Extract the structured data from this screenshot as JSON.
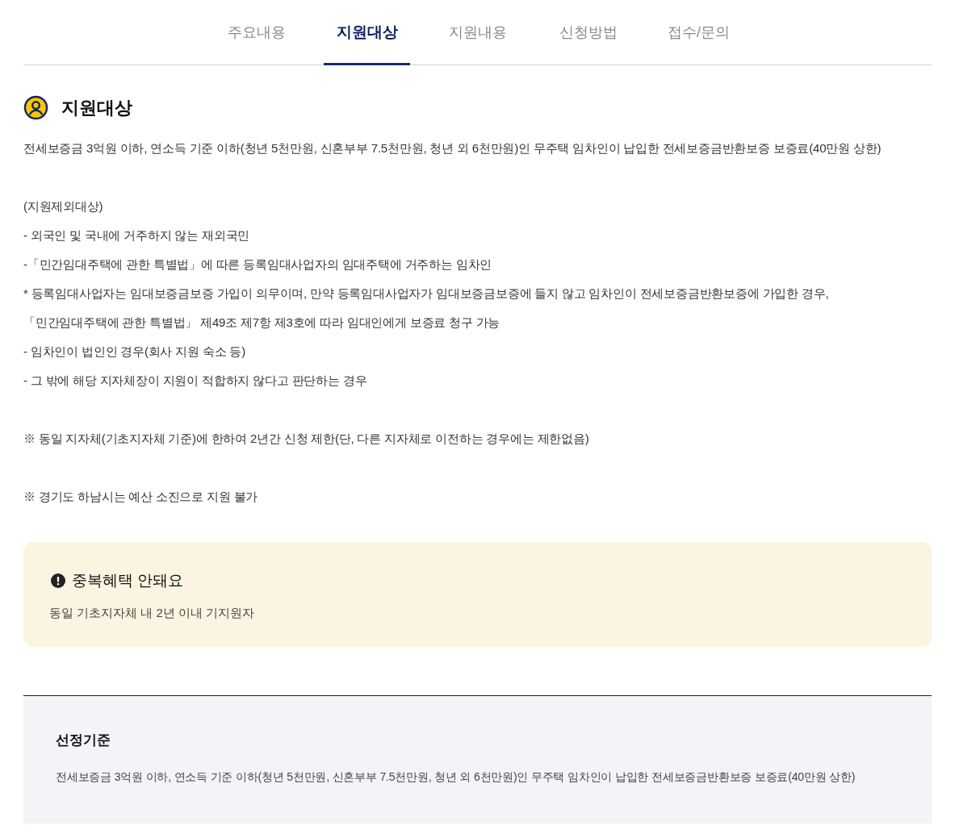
{
  "tabs": [
    {
      "label": "주요내용",
      "selected": false
    },
    {
      "label": "지원대상",
      "selected": true
    },
    {
      "label": "지원내용",
      "selected": false
    },
    {
      "label": "신청방법",
      "selected": false
    },
    {
      "label": "접수/문의",
      "selected": false
    }
  ],
  "section": {
    "title": "지원대상",
    "paragraphs": [
      [
        "전세보증금 3억원 이하, 연소득 기준 이하(청년 5천만원, 신혼부부 7.5천만원, 청년 외 6천만원)인 무주택 임차인이 납입한 전세보증금반환보증 보증료(40만원 상한)"
      ],
      [
        "(지원제외대상)",
        "- 외국인 및 국내에 거주하지 않는 재외국민",
        "-「민간임대주택에 관한 특별법」에 따른 등록임대사업자의 임대주택에 거주하는 임차인",
        "* 등록임대사업자는 임대보증금보증 가입이 의무이며, 만약 등록임대사업자가 임대보증금보증에 들지 않고 임차인이 전세보증금반환보증에 가입한 경우,",
        "「민간임대주택에 관한 특별법」 제49조 제7항 제3호에 따라 임대인에게 보증료 청구 가능",
        "- 임차인이 법인인 경우(회사 지원 숙소 등)",
        "- 그 밖에 해당 지자체장이 지원이 적합하지 않다고 판단하는 경우"
      ],
      [
        "※ 동일 지자체(기초지자체 기준)에 한하여 2년간 신청 제한(단, 다른 지자체로 이전하는 경우에는 제한없음)"
      ],
      [
        "※ 경기도 하남시는 예산 소진으로 지원 불가"
      ]
    ]
  },
  "notice": {
    "title": "중복혜택 안돼요",
    "text": "동일 기초지자체 내 2년 이내 기지원자"
  },
  "criteria": {
    "title": "선정기준",
    "text": "전세보증금 3억원 이하, 연소득 기준 이하(청년 5천만원, 신혼부부 7.5천만원, 청년 외 6천만원)인 무주택 임차인이 납입한 전세보증금반환보증 보증료(40만원 상한)"
  }
}
